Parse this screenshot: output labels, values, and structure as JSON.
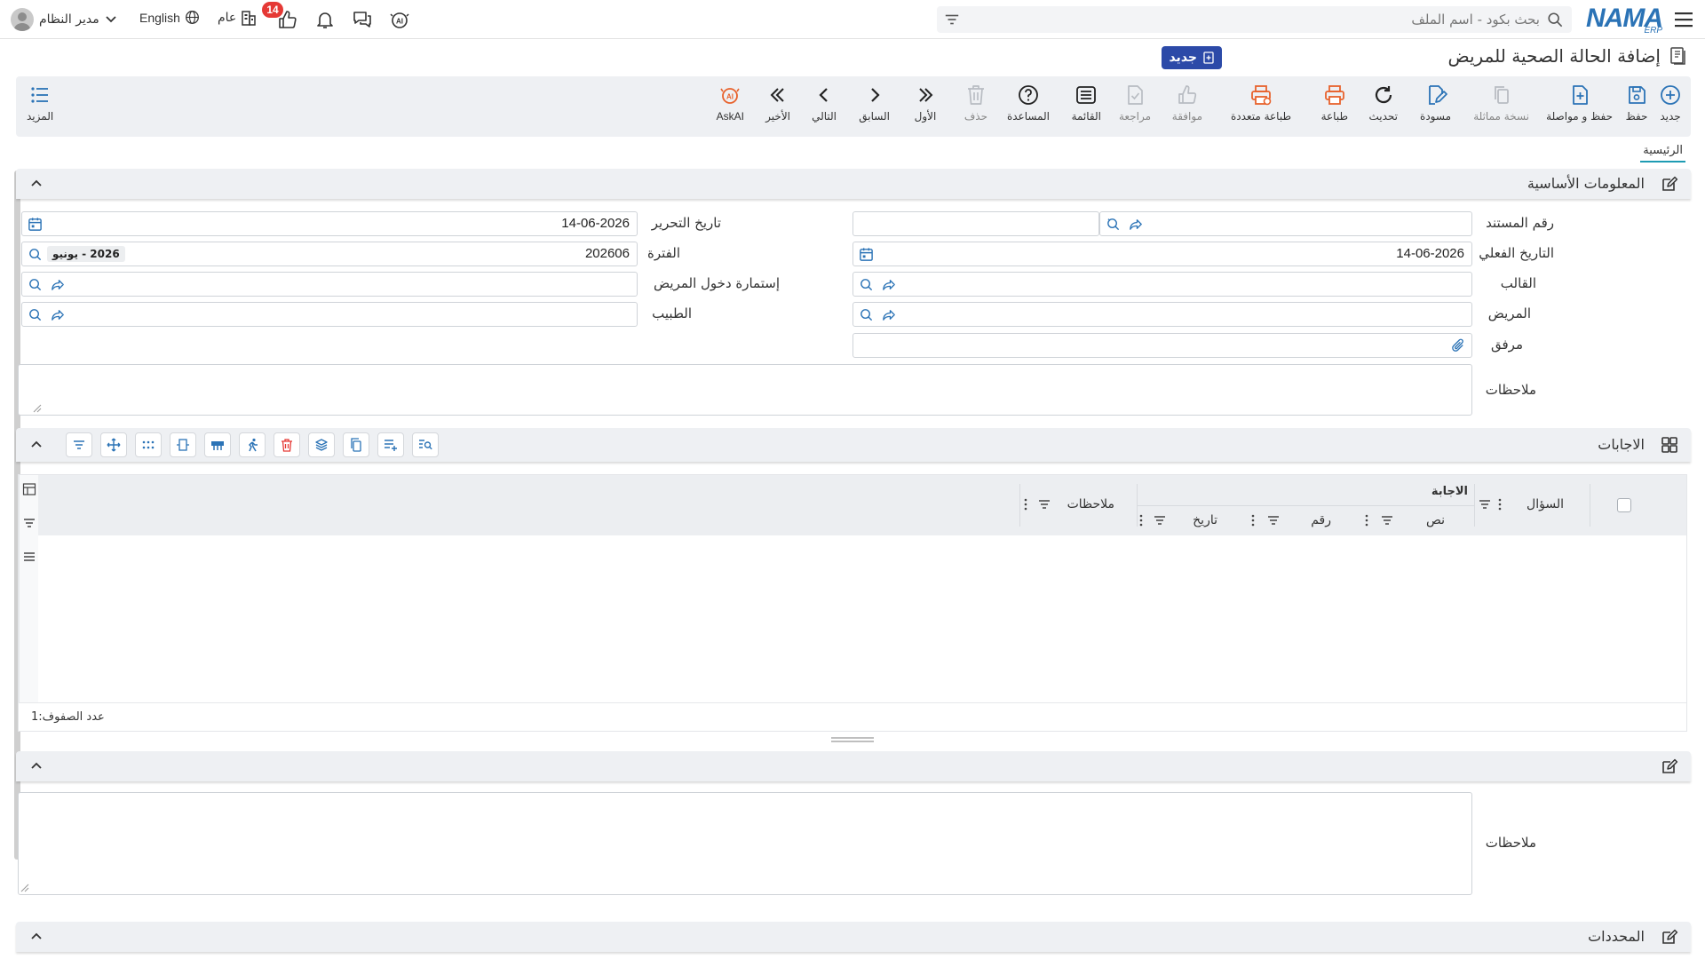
{
  "topbar": {
    "search_placeholder": "بحث بكود - اسم الملف",
    "user_name": "مدير النظام",
    "language": "English",
    "org": "عام",
    "likes_count": "14"
  },
  "logo": {
    "text": "NAMA",
    "sub": "ERP"
  },
  "page": {
    "title": "إضافة الحالة الصحية للمريض",
    "status_badge": "جديد"
  },
  "toolbar": {
    "new": "جديد",
    "save": "حفظ",
    "save_continue": "حفظ و مواصلة",
    "duplicate": "نسخة مماثلة",
    "draft": "مسودة",
    "refresh": "تحديث",
    "print": "طباعة",
    "multi_print": "طباعة متعددة",
    "approve": "موافقة",
    "review": "مراجعة",
    "list": "القائمة",
    "help": "المساعدة",
    "delete": "حذف",
    "first": "الأول",
    "previous": "السابق",
    "next": "التالي",
    "last": "الأخير",
    "askai": "AskAI",
    "more": "المزيد",
    "askai_badge": "AI"
  },
  "tabs": {
    "main": "الرئيسية"
  },
  "basic_info": {
    "title": "المعلومات الأساسية",
    "doc_number_label": "رقم المستند",
    "doc_number_value": "",
    "edit_date_label": "تاريخ التحرير",
    "edit_date_value": "14-06-2026",
    "actual_date_label": "التاريخ الفعلي",
    "actual_date_value": "14-06-2026",
    "period_label": "الفترة",
    "period_value": "202606",
    "period_chip": "2026 - يونيو",
    "template_label": "القالب",
    "admission_form_label": "إستمارة دخول المريض",
    "patient_label": "المريض",
    "doctor_label": "الطبيب",
    "attachment_label": "مرفق",
    "notes_label": "ملاحظات"
  },
  "answers": {
    "title": "الاجابات",
    "columns": {
      "question": "السؤال",
      "answer_group": "الاجابة",
      "text": "نص",
      "number": "رقم",
      "date": "تاريخ",
      "notes": "ملاحظات"
    },
    "row_count_label": "عدد الصفوف:",
    "row_count": "1"
  },
  "notes_section": {
    "notes_label": "ملاحظات"
  },
  "dimensions_section": {
    "title": "المحددات"
  },
  "colors": {
    "accent": "#2b73b6",
    "brand_badge": "#2c4aa8",
    "print_orange": "#e8622c",
    "tab_underline": "#1d9bb3",
    "danger": "#e53935"
  }
}
